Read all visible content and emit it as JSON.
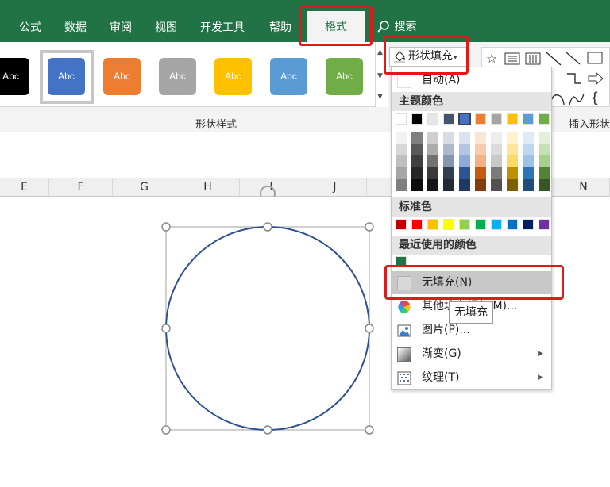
{
  "ribbon": {
    "tabs": [
      "公式",
      "数据",
      "审阅",
      "视图",
      "开发工具",
      "帮助"
    ],
    "active_tab": "格式",
    "search_label": "搜索"
  },
  "gallery": {
    "swatches": [
      {
        "label": "Abc",
        "color": "#000000"
      },
      {
        "label": "Abc",
        "color": "#4472c4"
      },
      {
        "label": "Abc",
        "color": "#ed7d31"
      },
      {
        "label": "Abc",
        "color": "#a5a5a5"
      },
      {
        "label": "Abc",
        "color": "#ffc000"
      },
      {
        "label": "Abc",
        "color": "#5b9bd5"
      },
      {
        "label": "Abc",
        "color": "#70ad47"
      }
    ],
    "group_label": "形状样式"
  },
  "insert_group_label": "插入形状",
  "shape_fill_button": "形状填充",
  "columns": [
    "E",
    "F",
    "G",
    "H",
    "I",
    "J",
    "N"
  ],
  "menu": {
    "auto_label": "自动(A)",
    "theme_colors_header": "主题颜色",
    "theme_top": [
      "#ffffff",
      "#000000",
      "#e7e6e6",
      "#44546a",
      "#4472c4",
      "#ed7d31",
      "#a5a5a5",
      "#ffc000",
      "#5b9bd5",
      "#70ad47"
    ],
    "theme_shades": [
      [
        "#f2f2f2",
        "#7f7f7f",
        "#d0cece",
        "#d6dce4",
        "#d9e2f3",
        "#fbe5d5",
        "#ededed",
        "#fff2cc",
        "#deebf6",
        "#e2efd9"
      ],
      [
        "#d8d8d8",
        "#595959",
        "#aeabab",
        "#adb9ca",
        "#b4c6e7",
        "#f7cbac",
        "#dbdbdb",
        "#fee599",
        "#bdd7ee",
        "#c5e0b3"
      ],
      [
        "#bfbfbf",
        "#3f3f3f",
        "#757070",
        "#8496b0",
        "#8eaadb",
        "#f4b183",
        "#c9c9c9",
        "#ffd965",
        "#9cc3e5",
        "#a8d08d"
      ],
      [
        "#a5a5a5",
        "#262626",
        "#3a3838",
        "#323f4f",
        "#2f5496",
        "#c55a11",
        "#7b7b7b",
        "#bf9000",
        "#2e75b5",
        "#538135"
      ],
      [
        "#7f7f7f",
        "#0c0c0c",
        "#171616",
        "#222a35",
        "#1f3864",
        "#833c0b",
        "#525252",
        "#7f6000",
        "#1e4e79",
        "#375623"
      ]
    ],
    "standard_colors_header": "标准色",
    "standard_colors": [
      "#c00000",
      "#ff0000",
      "#ffc000",
      "#ffff00",
      "#92d050",
      "#00b050",
      "#00b0f0",
      "#0070c0",
      "#002060",
      "#7030a0"
    ],
    "recent_colors_header": "最近使用的颜色",
    "recent_colors": [
      "#217346"
    ],
    "no_fill_label": "无填充(N)",
    "more_colors_label": "其他填充颜色(M)...",
    "picture_label": "图片(P)...",
    "gradient_label": "渐变(G)",
    "texture_label": "纹理(T)"
  },
  "tooltip": "无填充",
  "colors": {
    "excel_green": "#217346",
    "highlight_red": "#e01a1a",
    "circle_stroke": "#2f528f"
  }
}
